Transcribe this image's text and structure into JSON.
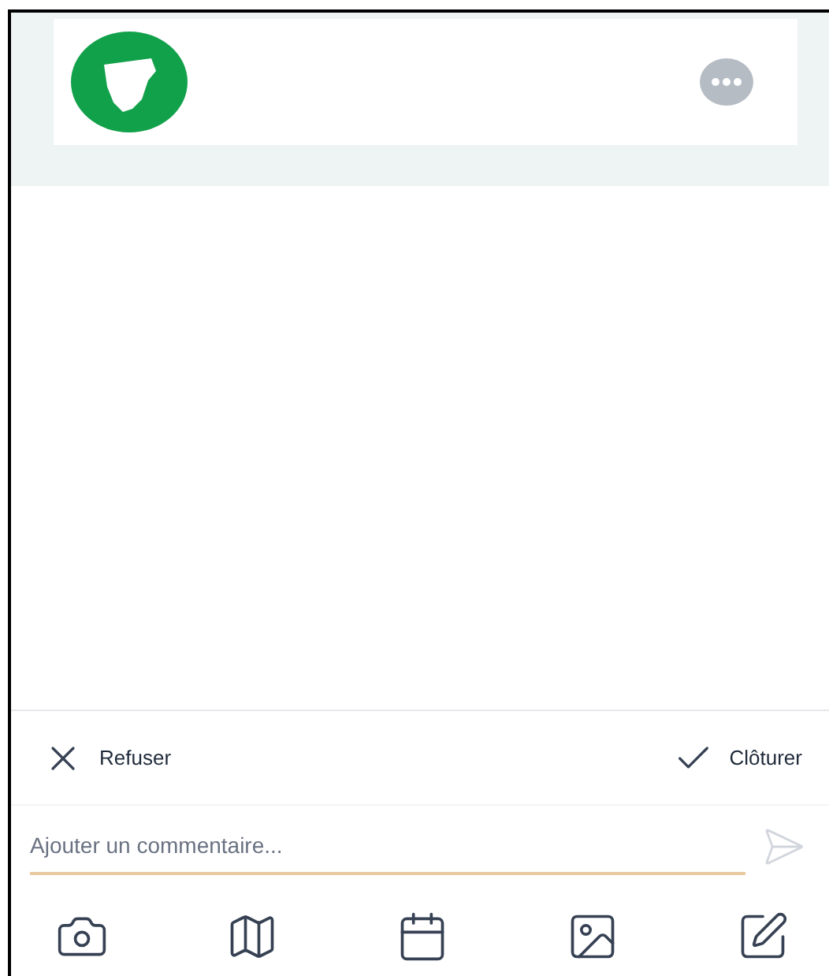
{
  "actions": [
    {
      "kind": "reject",
      "label": "Refuser"
    },
    {
      "kind": "close",
      "label": "Clôturer"
    }
  ],
  "comment": {
    "placeholder": "Ajouter un commentaire..."
  }
}
